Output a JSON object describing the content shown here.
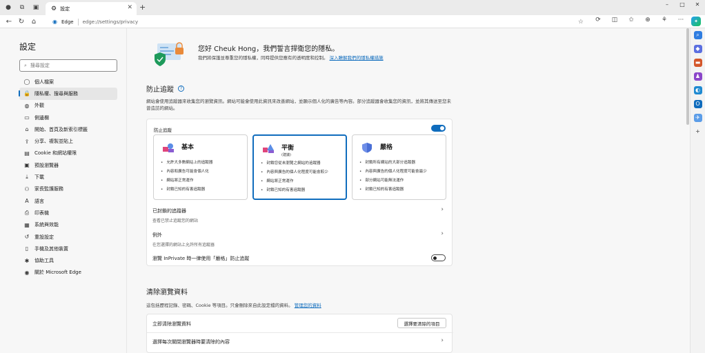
{
  "tabbar": {
    "tab_title": "設定",
    "window_controls": [
      "–",
      "□",
      "✕"
    ]
  },
  "addressbar": {
    "site_label": "Edge",
    "url": "edge://settings/privacy"
  },
  "sidebar": {
    "title": "設定",
    "search_placeholder": "搜尋設定",
    "items": [
      {
        "label": "個人檔案",
        "icon": "person-icon"
      },
      {
        "label": "隱私權、搜尋與服務",
        "icon": "lock-icon",
        "active": true
      },
      {
        "label": "外觀",
        "icon": "palette-icon"
      },
      {
        "label": "側邊欄",
        "icon": "sidebar-icon"
      },
      {
        "label": "開始、首頁及新索引標籤",
        "icon": "home-icon"
      },
      {
        "label": "分享、複製並貼上",
        "icon": "share-icon"
      },
      {
        "label": "Cookie 和網站權限",
        "icon": "cookie-icon"
      },
      {
        "label": "預設瀏覽器",
        "icon": "browser-icon"
      },
      {
        "label": "下載",
        "icon": "download-icon"
      },
      {
        "label": "家長監護服務",
        "icon": "family-icon"
      },
      {
        "label": "語言",
        "icon": "language-icon"
      },
      {
        "label": "印表機",
        "icon": "printer-icon"
      },
      {
        "label": "系統與效能",
        "icon": "system-icon"
      },
      {
        "label": "重設設定",
        "icon": "reset-icon"
      },
      {
        "label": "手機及其他裝置",
        "icon": "phone-icon"
      },
      {
        "label": "協助工具",
        "icon": "accessibility-icon"
      },
      {
        "label": "關於 Microsoft Edge",
        "icon": "edge-icon"
      }
    ]
  },
  "hero": {
    "title": "您好 Cheuk Hong，我們誓言捍衛您的隱私。",
    "desc": "我們將保護並尊重您的隱私權，同時提供您應有的透明度和控制。",
    "link": "深入瞭解我們的隱私權措施"
  },
  "tracking": {
    "title": "防止追蹤",
    "desc": "網站會使用追蹤器來收集您的瀏覽資訊。網站可能會使用此資訊來改善網站，並顯示個人化的廣告等內容。部分追蹤器會收集您的資訊，並將其傳送至您未曾造訪的網站。",
    "toggle_label": "防止追蹤",
    "cards": [
      {
        "name": "基本",
        "sub": "",
        "selected": false,
        "bullets": [
          "允許大多數網站上的追蹤器",
          "內容和廣告可能會個人化",
          "網站將正常運作",
          "封鎖已知的有害追蹤器"
        ]
      },
      {
        "name": "平衡",
        "sub": "(建議)",
        "selected": true,
        "bullets": [
          "封鎖您從未瀏覽之網站的追蹤器",
          "內容與廣告的個人化程度可能會較少",
          "網站將正常運作",
          "封鎖已知的有害追蹤器"
        ]
      },
      {
        "name": "嚴格",
        "sub": "",
        "selected": false,
        "bullets": [
          "封鎖所有網站的大部分追蹤器",
          "內容與廣告的個人化程度可能會最少",
          "部分網站可能無法運作",
          "封鎖已知的有害追蹤器"
        ]
      }
    ],
    "blocked_label": "已封鎖的追蹤器",
    "blocked_sub": "查看已禁止追蹤您的網站",
    "exceptions_label": "例外",
    "exceptions_sub": "在您選擇的網站上允許所有追蹤器",
    "inprivate_label": "瀏覽 InPrivate 時一律使用「嚴格」防止追蹤"
  },
  "clear": {
    "title": "清除瀏覽資料",
    "desc": "這包括歷程記錄、密碼、Cookie 等項目。只會刪除來自此設定檔的資料。",
    "desc_link": "管理您的資料",
    "row1": "立即清除瀏覽資料",
    "row1_button": "選擇要清除的項目",
    "row2": "選擇每次關閉瀏覽器時要清除的內容"
  }
}
